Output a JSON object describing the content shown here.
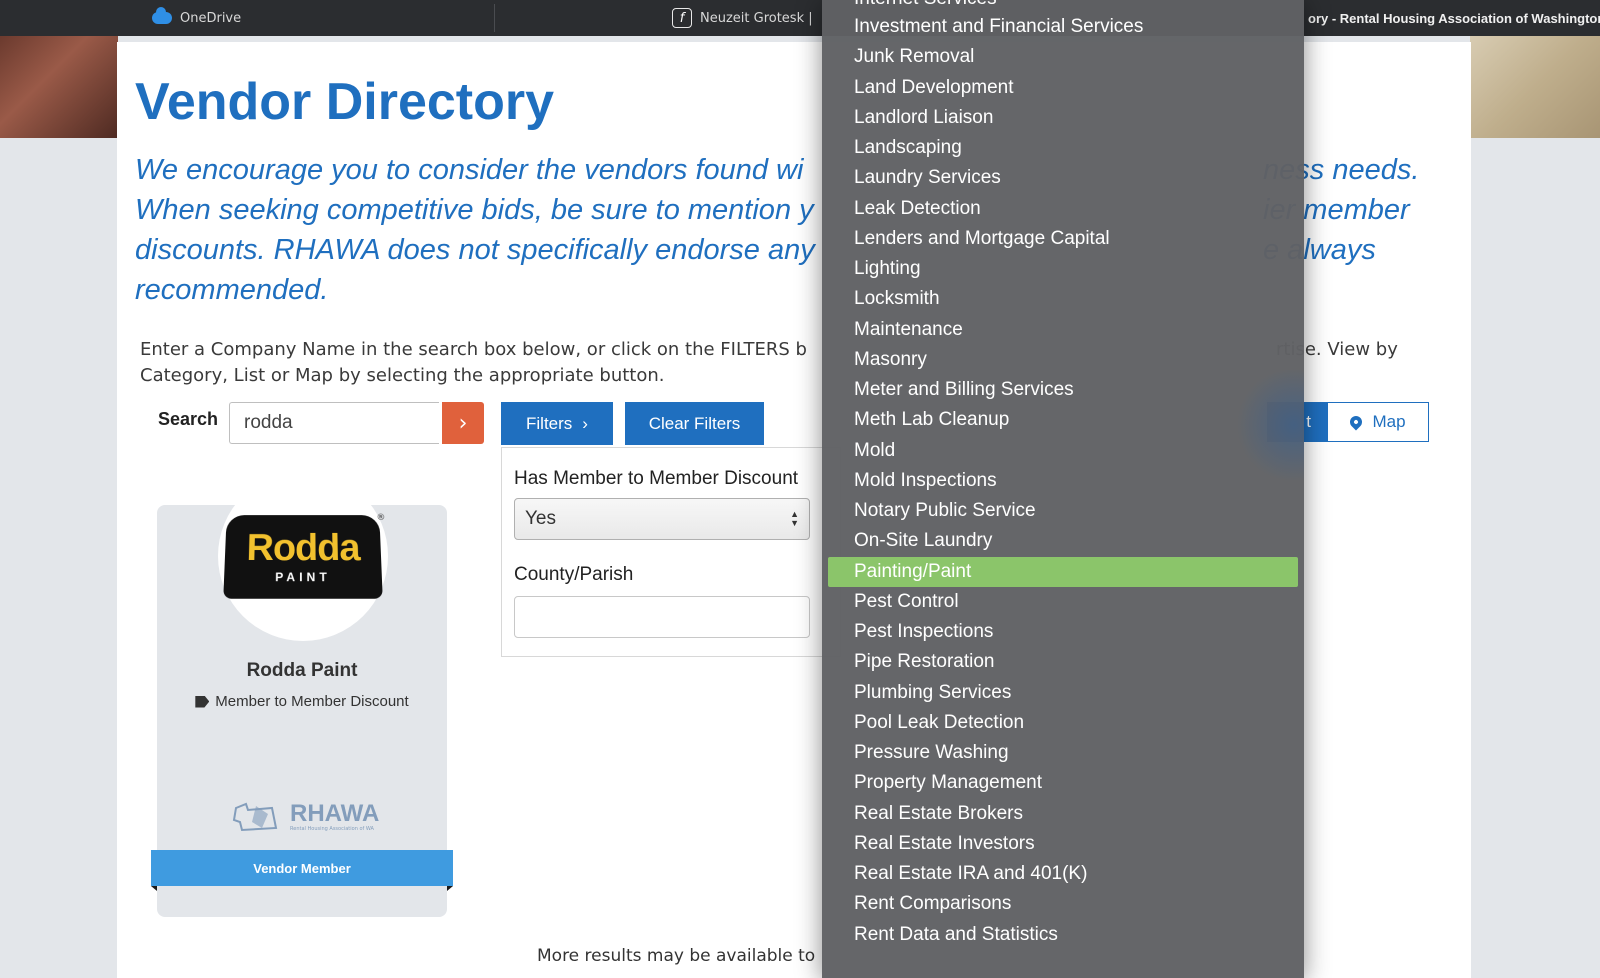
{
  "browser": {
    "bookmark_1": "OneDrive",
    "bookmark_2": "Neuzeit Grotesk |",
    "tab_title": "ory - Rental Housing Association of Washington"
  },
  "page": {
    "title": "Vendor Directory",
    "intro_part1": "We encourage you to consider the vendors found wi",
    "intro_part2": "ness needs.",
    "intro_line2a": "When seeking competitive bids, be sure to mention y",
    "intro_line2b": "ier member",
    "intro_line3a": "discounts. RHAWA does not specifically endorse any",
    "intro_line3b": "e always",
    "intro_line4": "recommended.",
    "help_line1a": "Enter a Company Name in the search box below, or click on the FILTERS b",
    "help_line1b": "rtise. View by",
    "help_line2": "Category, List or Map by selecting the appropriate button."
  },
  "search": {
    "label": "Search",
    "value": "rodda",
    "go_icon": "chevron-right-icon"
  },
  "buttons": {
    "filters": "Filters",
    "clear_filters": "Clear Filters",
    "list_partial": "t",
    "map": "Map"
  },
  "filters": {
    "member_discount_label": "Has Member to Member Discount",
    "member_discount_value": "Yes",
    "county_label": "County/Parish",
    "county_value": ""
  },
  "vendor_card": {
    "logo_word": "Rodda",
    "logo_sub": "PAINT",
    "logo_reg": "®",
    "name": "Rodda Paint",
    "discount_text": "Member to Member Discount",
    "rhawa_word": "RHAWA",
    "rhawa_sub": "Rental Housing Association of WA",
    "ribbon": "Vendor Member"
  },
  "footer_text": "More results may be available to",
  "dropdown": {
    "cut_item": "Internet Services",
    "items": [
      "Investment and Financial Services",
      "Junk Removal",
      "Land Development",
      "Landlord Liaison",
      "Landscaping",
      "Laundry Services",
      "Leak Detection",
      "Lenders and Mortgage Capital",
      "Lighting",
      "Locksmith",
      "Maintenance",
      "Masonry",
      "Meter and Billing Services",
      "Meth Lab Cleanup",
      "Mold",
      "Mold Inspections",
      "Notary Public Service",
      "On-Site Laundry",
      "Painting/Paint",
      "Pest Control",
      "Pest Inspections",
      "Pipe Restoration",
      "Plumbing Services",
      "Pool Leak Detection",
      "Pressure Washing",
      "Property Management",
      "Real Estate Brokers",
      "Real Estate Investors",
      "Real Estate IRA and 401(K)",
      "Rent Comparisons",
      "Rent Data and Statistics"
    ],
    "selected": "Painting/Paint"
  },
  "colors": {
    "brand_blue": "#1f6fbf",
    "search_button": "#e0613c",
    "selected_item": "#8bc56a",
    "ribbon": "#3f9be0"
  }
}
